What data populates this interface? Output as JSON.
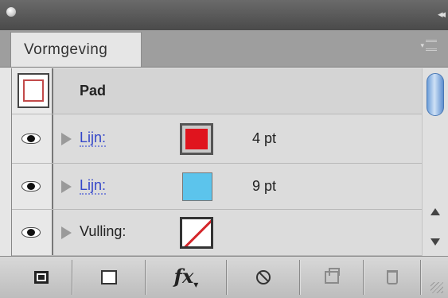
{
  "panel": {
    "tab_title": "Vormgeving"
  },
  "rows": {
    "pad": {
      "label": "Pad"
    },
    "stroke1": {
      "label": "Lijn:",
      "color": "#e0141e",
      "weight": "4 pt"
    },
    "stroke2": {
      "label": "Lijn:",
      "color": "#5cc4ec",
      "weight": "9 pt"
    },
    "fill": {
      "label": "Vulling:",
      "color": "none"
    }
  },
  "toolbar": {
    "fx_label": "fx"
  },
  "icons": [
    "close-icon",
    "collapse-icon",
    "panel-menu-icon",
    "visibility-eye-icon",
    "disclosure-triangle-icon",
    "add-stroke-icon",
    "add-fill-icon",
    "fx-icon",
    "clear-appearance-icon",
    "duplicate-item-icon",
    "trash-icon",
    "resize-grip-icon"
  ]
}
